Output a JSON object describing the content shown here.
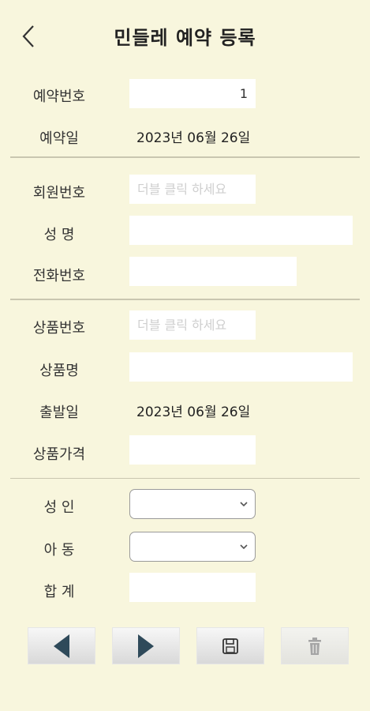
{
  "header": {
    "title": "민들레 예약 등록"
  },
  "reservation": {
    "number_label": "예약번호",
    "number_value": "1",
    "date_label": "예약일",
    "date_value": "2023년 06월 26일"
  },
  "member": {
    "id_label": "회원번호",
    "id_placeholder": "더블 클릭 하세요",
    "name_label": "성  명",
    "name_value": "",
    "phone_label": "전화번호",
    "phone_value": ""
  },
  "product": {
    "id_label": "상품번호",
    "id_placeholder": "더블 클릭 하세요",
    "name_label": "상품명",
    "name_value": "",
    "departure_label": "출발일",
    "departure_value": "2023년 06월 26일",
    "price_label": "상품가격",
    "price_value": ""
  },
  "count": {
    "adult_label": "성  인",
    "adult_value": "",
    "child_label": "아  동",
    "child_value": "",
    "total_label": "합  계",
    "total_value": ""
  },
  "toolbar": {
    "prev_icon": "triangle-left-icon",
    "next_icon": "triangle-right-icon",
    "save_icon": "floppy-disk-icon",
    "delete_icon": "trash-icon"
  },
  "colors": {
    "background": "#f8f6dd",
    "nav_arrow": "#2f4a5a"
  }
}
